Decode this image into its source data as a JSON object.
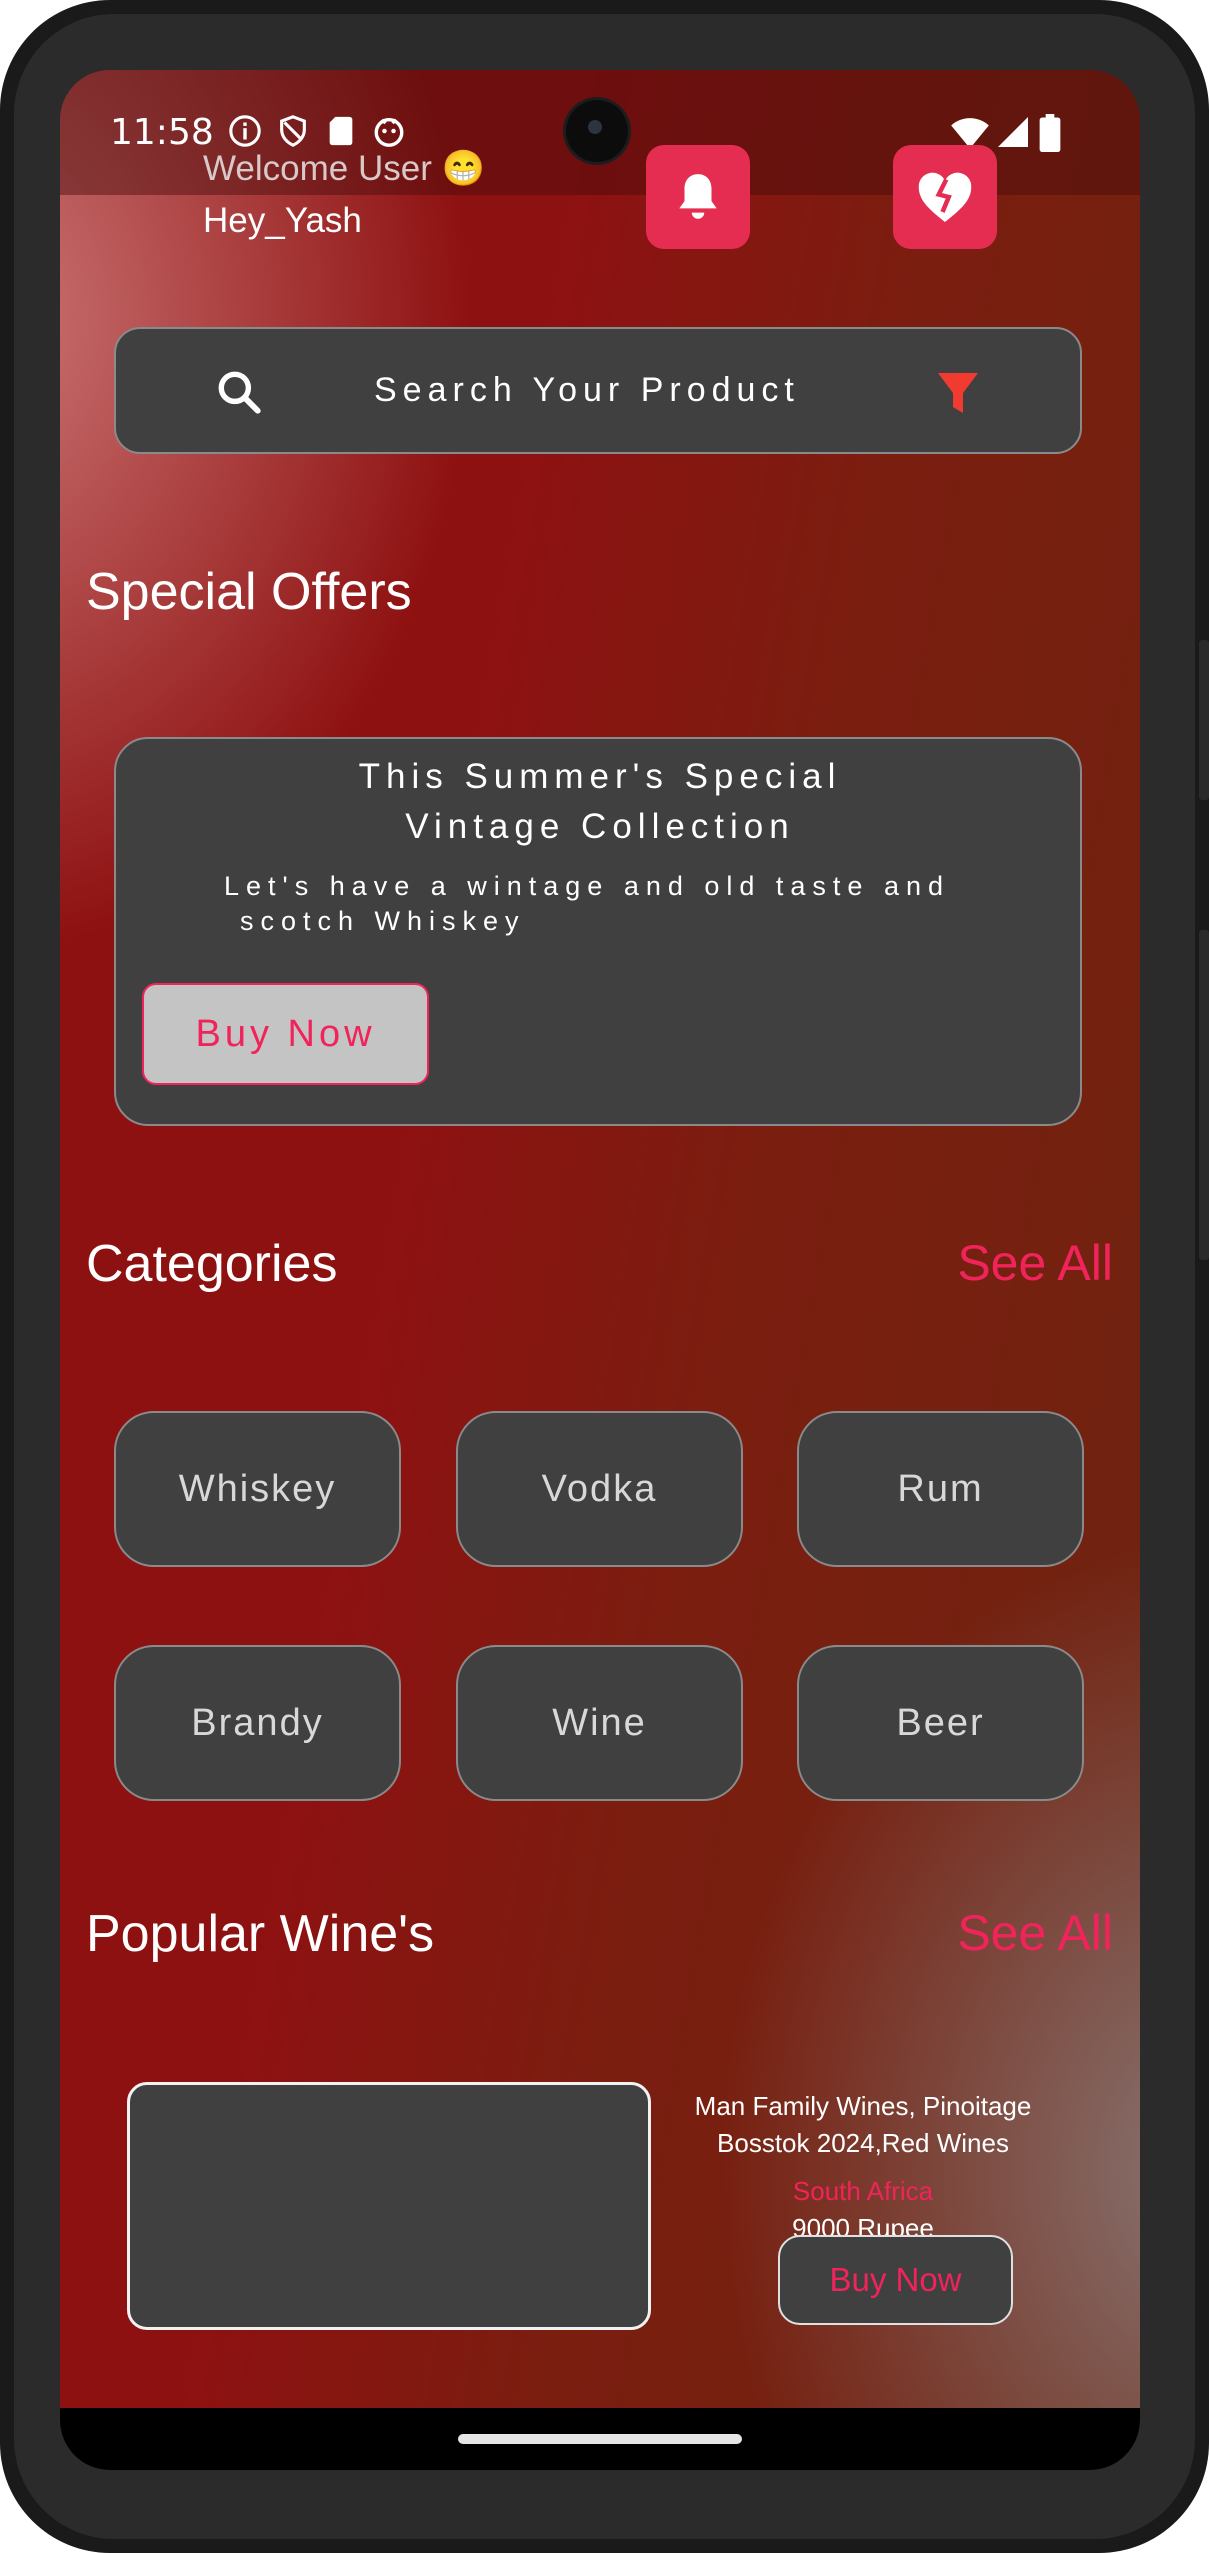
{
  "status_bar": {
    "time": "11:58",
    "left_icons": [
      "info-icon",
      "shield-icon",
      "sd-card-icon",
      "face-icon"
    ],
    "right_icons": [
      "wifi-icon",
      "signal-icon",
      "battery-icon"
    ]
  },
  "header": {
    "welcome": "Welcome User 😁",
    "username": "Hey_Yash",
    "notification_icon": "bell-icon",
    "wishlist_icon": "broken-heart-icon"
  },
  "search": {
    "placeholder": "Search Your Product",
    "search_icon": "search-icon",
    "filter_icon": "filter-icon"
  },
  "special_offers": {
    "title": "Special Offers",
    "card": {
      "title_line1": "This Summer's Special",
      "title_line2": "Vintage Collection",
      "subtitle_line1": "Let's have a wintage and old taste and",
      "subtitle_line2": "scotch Whiskey",
      "button": "Buy Now"
    }
  },
  "categories": {
    "title": "Categories",
    "see_all": "See All",
    "items": [
      "Whiskey",
      "Vodka",
      "Rum",
      "Brandy",
      "Wine",
      "Beer"
    ]
  },
  "popular": {
    "title": "Popular Wine's",
    "see_all": "See All",
    "item": {
      "name_line1": "Man Family Wines, Pinoitage",
      "name_line2": "Bosstok 2024,Red Wines",
      "country": "South Africa",
      "price": "9000 Rupee",
      "button": "Buy Now"
    }
  },
  "colors": {
    "accent": "#f0245a",
    "header_button": "#e52d52",
    "card": "#404040",
    "filter": "#f23b30"
  }
}
